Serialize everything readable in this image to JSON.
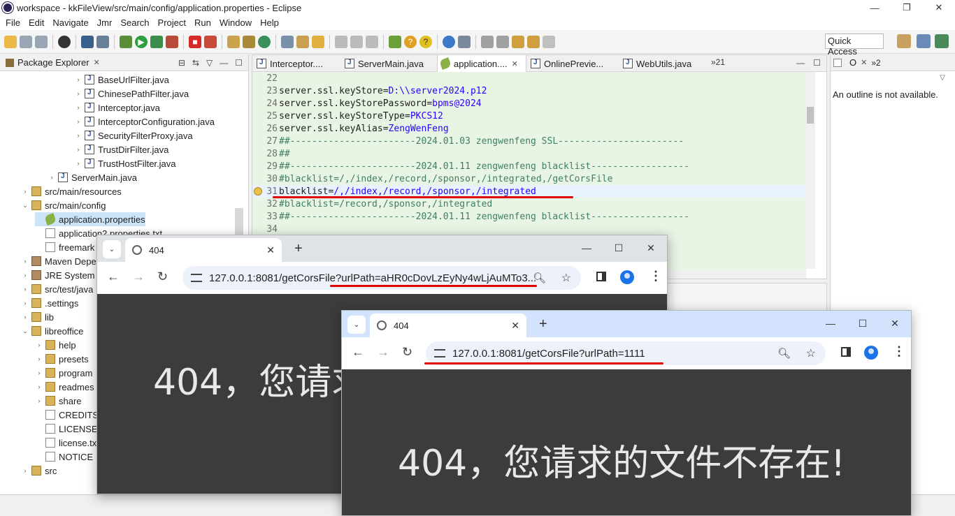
{
  "eclipse": {
    "window_title": "workspace - kkFileView/src/main/config/application.properties - Eclipse",
    "menu": [
      "File",
      "Edit",
      "Navigate",
      "Jmr",
      "Search",
      "Project",
      "Run",
      "Window",
      "Help"
    ],
    "quick_access": "Quick Access",
    "package_explorer": {
      "title": "Package Explorer",
      "items": [
        {
          "label": "BaseUrlFilter.java",
          "type": "java"
        },
        {
          "label": "ChinesePathFilter.java",
          "type": "java"
        },
        {
          "label": "Interceptor.java",
          "type": "java"
        },
        {
          "label": "InterceptorConfiguration.java",
          "type": "java"
        },
        {
          "label": "SecurityFilterProxy.java",
          "type": "java"
        },
        {
          "label": "TrustDirFilter.java",
          "type": "java"
        },
        {
          "label": "TrustHostFilter.java",
          "type": "java"
        },
        {
          "label": "ServerMain.java",
          "type": "java"
        },
        {
          "label": "src/main/resources",
          "type": "folder"
        },
        {
          "label": "src/main/config",
          "type": "folder"
        },
        {
          "label": "application.properties",
          "type": "props"
        },
        {
          "label": "application2.properties.txt",
          "type": "file"
        },
        {
          "label": "freemark",
          "type": "file"
        },
        {
          "label": "Maven Depe",
          "type": "lib"
        },
        {
          "label": "JRE System L",
          "type": "lib"
        },
        {
          "label": "src/test/java",
          "type": "folder"
        },
        {
          "label": ".settings",
          "type": "folder"
        },
        {
          "label": "lib",
          "type": "folder"
        },
        {
          "label": "libreoffice",
          "type": "folder"
        },
        {
          "label": "help",
          "type": "folder"
        },
        {
          "label": "presets",
          "type": "folder"
        },
        {
          "label": "program",
          "type": "folder"
        },
        {
          "label": "readmes",
          "type": "folder"
        },
        {
          "label": "share",
          "type": "folder"
        },
        {
          "label": "CREDITS.",
          "type": "file"
        },
        {
          "label": "LICENSE.",
          "type": "file"
        },
        {
          "label": "license.tx",
          "type": "file"
        },
        {
          "label": "NOTICE",
          "type": "file"
        },
        {
          "label": "src",
          "type": "folder"
        }
      ]
    },
    "editor_tabs": [
      {
        "label": "Interceptor...."
      },
      {
        "label": "ServerMain.java"
      },
      {
        "label": "application...."
      },
      {
        "label": "OnlinePrevie..."
      },
      {
        "label": "WebUtils.java"
      }
    ],
    "tab_overflow": "»21",
    "code_lines": [
      {
        "num": "22",
        "key": "",
        "val": "",
        "cmt": ""
      },
      {
        "num": "23",
        "key": "server.ssl.keyStore=",
        "val": "D:\\\\server2024.p12",
        "cmt": ""
      },
      {
        "num": "24",
        "key": "server.ssl.keyStorePassword=",
        "val": "bpms@2024",
        "cmt": ""
      },
      {
        "num": "25",
        "key": "server.ssl.keyStoreType=",
        "val": "PKCS12",
        "cmt": ""
      },
      {
        "num": "26",
        "key": "server.ssl.keyAlias=",
        "val": "ZengWenFeng",
        "cmt": ""
      },
      {
        "num": "27",
        "key": "",
        "val": "",
        "cmt": "##-----------------------2024.01.03 zengwenfeng SSL-----------------------"
      },
      {
        "num": "28",
        "key": "",
        "val": "",
        "cmt": "##"
      },
      {
        "num": "29",
        "key": "",
        "val": "",
        "cmt": "##-----------------------2024.01.11 zengwenfeng blacklist------------------"
      },
      {
        "num": "30",
        "key": "",
        "val": "",
        "cmt": "#blacklist=/,/index,/record,/sponsor,/integrated,/getCorsFile"
      },
      {
        "num": "31",
        "key": "blacklist=",
        "val": "/,/index,/record,/sponsor,/integrated",
        "cmt": ""
      },
      {
        "num": "32",
        "key": "",
        "val": "",
        "cmt": "#blacklist=/record,/sponsor,/integrated"
      },
      {
        "num": "33",
        "key": "",
        "val": "",
        "cmt": "##-----------------------2024.01.11 zengwenfeng blacklist------------------"
      },
      {
        "num": "34",
        "key": "",
        "val": "",
        "cmt": ""
      }
    ],
    "outline": {
      "tab_label": "O",
      "tab_overflow": "»2",
      "message": "An outline is not available."
    }
  },
  "browser1": {
    "tab_title": "404",
    "url": "127.0.0.1:8081/getCorsFile?urlPath=aHR0cDovLzEyNy4wLjAuMTo3...",
    "message": "404，您请求"
  },
  "browser2": {
    "tab_title": "404",
    "url": "127.0.0.1:8081/getCorsFile?urlPath=1111",
    "message": "404，您请求的文件不存在!"
  },
  "colors": {
    "annotation_underline": "#e00000",
    "code_value": "#2a00ff",
    "code_comment": "#3f7f5f",
    "editor_bg": "#e8f5e5",
    "browser_content_bg": "#3c3c3c"
  }
}
